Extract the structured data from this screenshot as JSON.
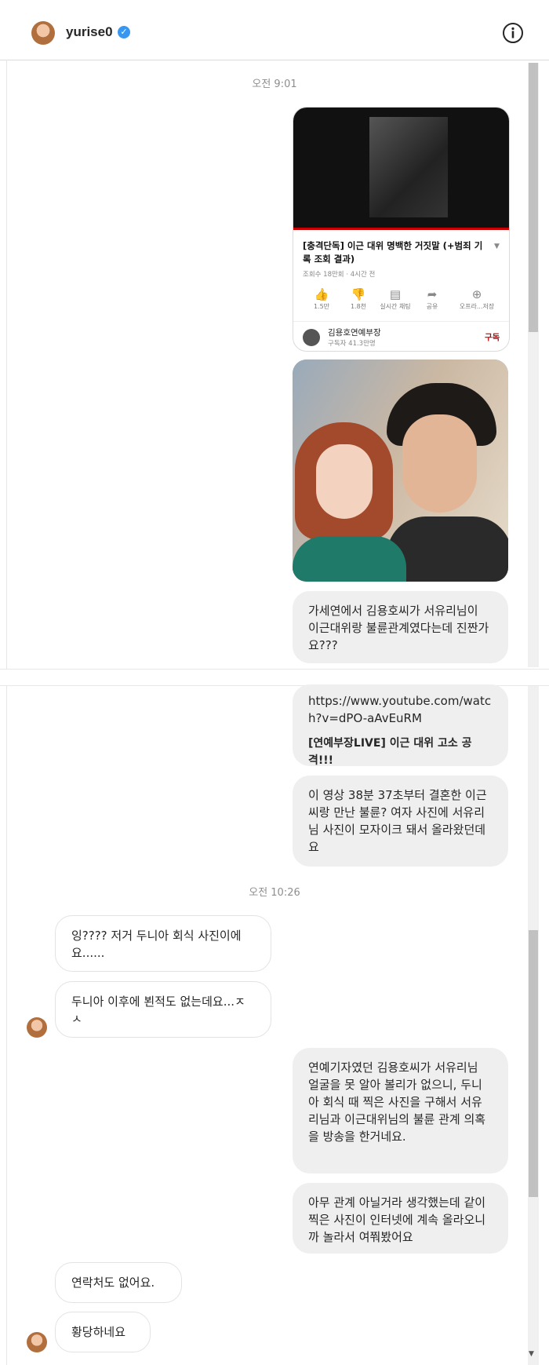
{
  "header": {
    "username": "yurise0",
    "verified_icon": "verified-badge-icon",
    "info_icon": "info-icon"
  },
  "times": {
    "t1": "오전 9:01",
    "t2": "오전 10:26"
  },
  "youtube_card": {
    "title": "[충격단독] 이근 대위 명백한 거짓말 (+범죄 기록 조회 결과)",
    "meta": "조회수 18만회 · 4시간 전",
    "actions": [
      {
        "icon": "thumbs-up-icon",
        "glyph": "👍",
        "label": "1.5만"
      },
      {
        "icon": "thumbs-down-icon",
        "glyph": "👎",
        "label": "1.8천"
      },
      {
        "icon": "chat-icon",
        "glyph": "▤",
        "label": "실시간 채팅"
      },
      {
        "icon": "share-icon",
        "glyph": "➦",
        "label": "공유"
      },
      {
        "icon": "save-icon",
        "glyph": "⊕",
        "label": "오프라...저장"
      }
    ],
    "channel_name": "김용호연예부장",
    "channel_subs": "구독자 41.3만명",
    "subscribe": "구독"
  },
  "messages": {
    "m1": "가세연에서 김용호씨가 서유리님이 이근대위랑 불륜관계였다는데 진짠가요???",
    "m2_link": "https://www.youtube.com/watch?v=dPO-aAvEuRM",
    "m2_title": "[연예부장LIVE] 이근 대위 고소 공격!!!",
    "m3": "이 영상 38분 37초부터 결혼한 이근씨랑 만난 불륜? 여자 사진에 서유리님 사진이 모자이크 돼서 올라왔던데요",
    "r1": "잉???? 저거 두니아 회식 사진이에요......",
    "r2": "두니아 이후에 뵌적도 없는데요...ㅈㅅ",
    "m4": "연예기자였던 김용호씨가 서유리님 얼굴을 못 알아 볼리가 없으니, 두니아 회식 때 찍은 사진을 구해서 서유리님과 이근대위님의 불륜 관계 의혹을 방송을 한거네요.",
    "m5": "아무 관계 아닐거라 생각했는데 같이 찍은 사진이 인터넷에 계속 올라오니까 놀라서 여쭤봤어요",
    "r3": "연락처도 없어요.",
    "r4": "황당하네요"
  }
}
